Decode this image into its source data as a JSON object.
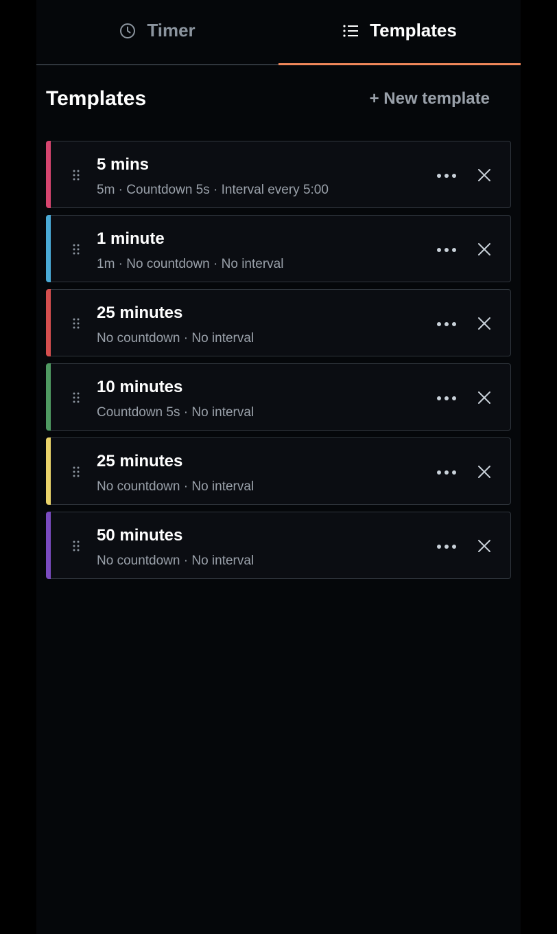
{
  "tabs": [
    {
      "label": "Timer",
      "icon": "clock-icon",
      "active": false
    },
    {
      "label": "Templates",
      "icon": "list-icon",
      "active": true
    }
  ],
  "header": {
    "title": "Templates",
    "new_template_label": "+ New template"
  },
  "accent_color": "#f0875a",
  "templates": [
    {
      "title": "5 mins",
      "subtitle": "5m · Countdown 5s · Interval every 5:00",
      "color": "#d6456f"
    },
    {
      "title": "1 minute",
      "subtitle": "1m · No countdown · No interval",
      "color": "#4aaad6"
    },
    {
      "title": "25 minutes",
      "subtitle": "No countdown · No interval",
      "color": "#d44e4e"
    },
    {
      "title": "10 minutes",
      "subtitle": "Countdown 5s · No interval",
      "color": "#4f9a62"
    },
    {
      "title": "25 minutes",
      "subtitle": "No countdown · No interval",
      "color": "#e9d36a"
    },
    {
      "title": "50 minutes",
      "subtitle": "No countdown · No interval",
      "color": "#7a4bc0"
    }
  ]
}
